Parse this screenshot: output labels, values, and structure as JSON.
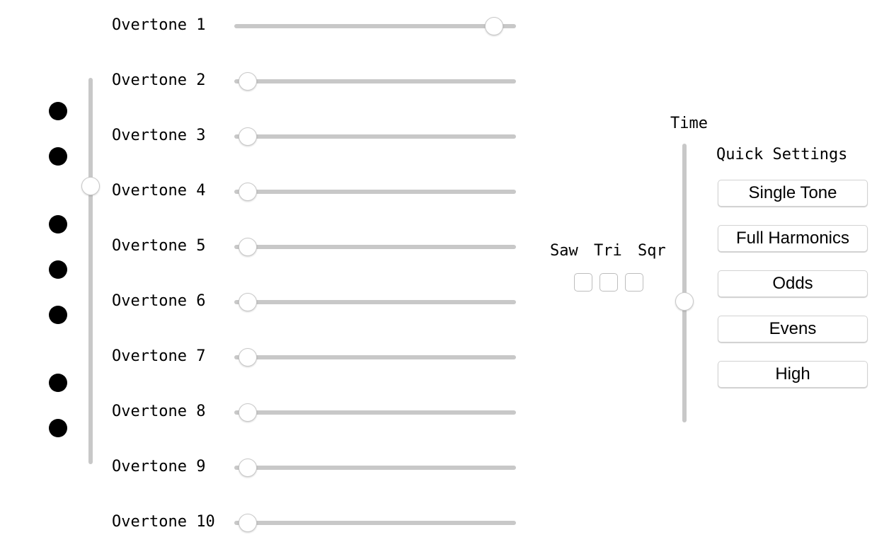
{
  "overtones": [
    {
      "label": "Overtone 1",
      "value": 0.95
    },
    {
      "label": "Overtone 2",
      "value": 0.0
    },
    {
      "label": "Overtone 3",
      "value": 0.0
    },
    {
      "label": "Overtone 4",
      "value": 0.0
    },
    {
      "label": "Overtone 5",
      "value": 0.0
    },
    {
      "label": "Overtone 6",
      "value": 0.0
    },
    {
      "label": "Overtone 7",
      "value": 0.0
    },
    {
      "label": "Overtone 8",
      "value": 0.0
    },
    {
      "label": "Overtone 9",
      "value": 0.0
    },
    {
      "label": "Overtone 10",
      "value": 0.0
    }
  ],
  "left_slider": {
    "value": 0.73
  },
  "indicator_dots": {
    "count": 7,
    "color": "#000000"
  },
  "waveforms": {
    "labels": [
      "Saw",
      "Tri",
      "Sqr"
    ],
    "checked": [
      false,
      false,
      false
    ]
  },
  "time": {
    "label": "Time",
    "value": 0.43
  },
  "quick_settings": {
    "title": "Quick Settings",
    "buttons": [
      "Single Tone",
      "Full Harmonics",
      "Odds",
      "Evens",
      "High"
    ]
  },
  "colors": {
    "track": "#c8c8c8",
    "thumb": "#ffffff",
    "dot": "#000000"
  }
}
